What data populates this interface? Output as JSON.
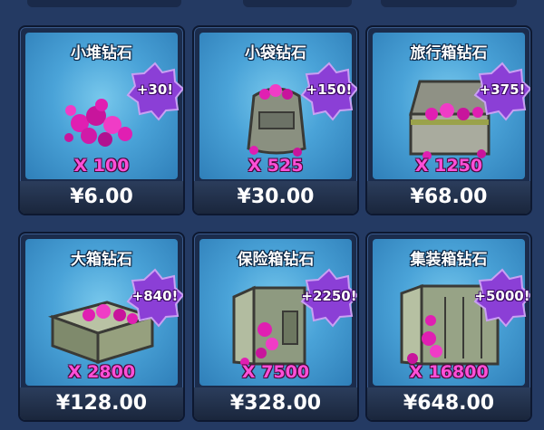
{
  "packs": [
    {
      "title": "小堆钻石",
      "bonus": "+30!",
      "qty": "X 100",
      "price": "¥6.00",
      "icon": "gem-pile-icon"
    },
    {
      "title": "小袋钻石",
      "bonus": "+150!",
      "qty": "X 525",
      "price": "¥30.00",
      "icon": "gem-bag-icon"
    },
    {
      "title": "旅行箱钻石",
      "bonus": "+375!",
      "qty": "X 1250",
      "price": "¥68.00",
      "icon": "gem-chest-icon"
    },
    {
      "title": "大箱钻石",
      "bonus": "+840!",
      "qty": "X 2800",
      "price": "¥128.00",
      "icon": "gem-crate-icon"
    },
    {
      "title": "保险箱钻石",
      "bonus": "+2250!",
      "qty": "X 7500",
      "price": "¥328.00",
      "icon": "gem-safe-icon"
    },
    {
      "title": "集装箱钻石",
      "bonus": "+5000!",
      "qty": "X 16800",
      "price": "¥648.00",
      "icon": "gem-container-icon"
    }
  ],
  "colors": {
    "gem": "#e01fb2",
    "bonus_badge": "#8b3fd6",
    "panel": "#4aa3d8",
    "quantity": "#ff4fd8"
  }
}
